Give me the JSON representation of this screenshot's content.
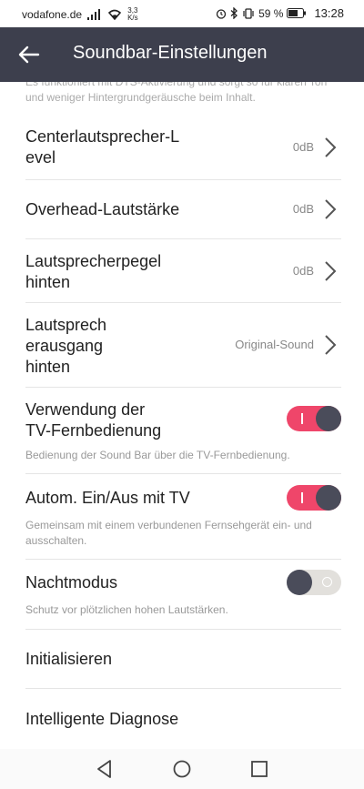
{
  "status_bar": {
    "carrier": "vodafone.de",
    "network_speed_value": "3,3",
    "network_speed_unit": "K/s",
    "battery_percent": "59 %",
    "time": "13:28"
  },
  "app_bar": {
    "title": "Soundbar-Einstellungen"
  },
  "cutoff_text": "Es funktioniert mit DTS-Aktivierung und sorgt so für klaren Ton und weniger Hintergrundgeräusche beim Inhalt.",
  "settings": [
    {
      "label": "Centerlautsprecher-L\nevel",
      "value": "0dB"
    },
    {
      "label": "Overhead-Lautstärke",
      "value": "0dB"
    },
    {
      "label": "Lautsprecherpegel\nhinten",
      "value": "0dB"
    },
    {
      "label": "Lautsprech\nerausgang\nhinten",
      "value": "Original-Sound"
    },
    {
      "label": "Verwendung der\nTV-Fernbedienung",
      "toggle": "on",
      "description": "Bedienung der Sound Bar über die TV-Fernbedienung."
    },
    {
      "label": "Autom. Ein/Aus mit TV",
      "toggle": "on",
      "description": "Gemeinsam mit einem verbundenen Fernsehgerät ein- und ausschalten."
    },
    {
      "label": "Nachtmodus",
      "toggle": "off",
      "description": "Schutz vor plötzlichen hohen Lautstärken."
    },
    {
      "label": "Initialisieren"
    },
    {
      "label": "Intelligente Diagnose"
    }
  ],
  "colors": {
    "app_bar": "#3d3f4d",
    "toggle_on": "#ef466a",
    "toggle_off": "#e2e0dc",
    "knob": "#4a4c5a"
  }
}
